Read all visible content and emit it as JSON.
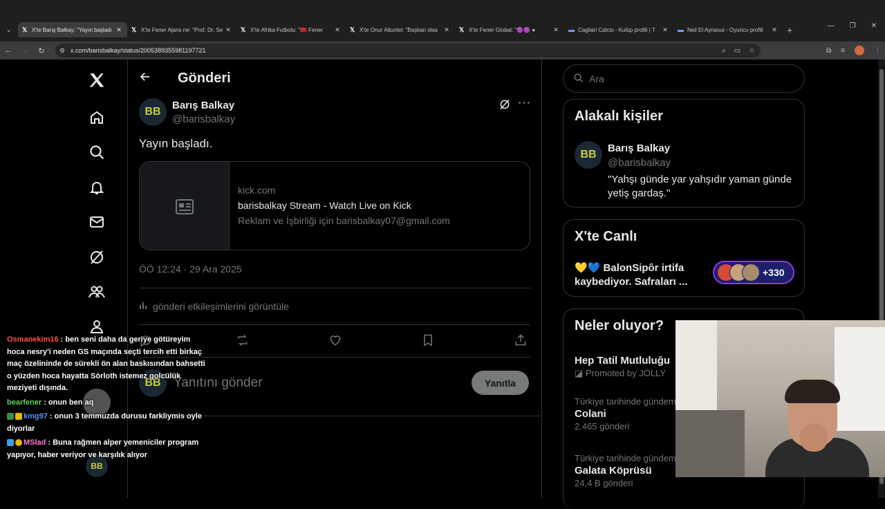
{
  "browser": {
    "tabs": [
      {
        "title": "X'te Barış Balkay: \"Yayın başladı",
        "active": true
      },
      {
        "title": "X'te Fener Ajans ne: \"Prof. Dr. Se",
        "active": false
      },
      {
        "title": "X'te Afrika Futbolu: \"🇲🇦 Fener",
        "active": false
      },
      {
        "title": "X'te Onur Altuntel: \"Başkan olsa",
        "active": false
      },
      {
        "title": "X'te Fener Global: \"🟣🟣 ●",
        "active": false
      },
      {
        "title": "Cagliari Calcio - Kulüp profili | T",
        "active": false
      },
      {
        "title": "Neil El Aynaoui - Oyuncu profili",
        "active": false
      }
    ],
    "url": "x.com/barisbalkay/status/2005389355981197721"
  },
  "main": {
    "header_title": "Gönderi",
    "author": {
      "name": "Barış Balkay",
      "handle": "@barisbalkay",
      "avatar_text": "BB"
    },
    "text": "Yayın başladı.",
    "card": {
      "domain": "kick.com",
      "title": "barisbalkay Stream - Watch Live on Kick",
      "description": "Reklam ve İşbirliği için barisbalkay07@gmail.com"
    },
    "timestamp": "ÖÖ 12:24 · 29 Ara 2025",
    "engagement_link": "gönderi etkileşimlerini görüntüle",
    "reply_placeholder": "Yanıtını gönder",
    "reply_button": "Yanıtla"
  },
  "right": {
    "search_placeholder": "Ara",
    "related_title": "Alakalı kişiler",
    "related": {
      "name": "Barış Balkay",
      "handle": "@barisbalkay",
      "bio": "\"Yahşı günde yar yahşıdır yaman günde yetiş gardaş.\""
    },
    "live_title": "X'te Canlı",
    "live": {
      "text": "💛💙 BalonSipôr irtifa kaybediyor. Safraları ...",
      "count": "+330"
    },
    "trends_title": "Neler oluyor?",
    "trends": [
      {
        "meta": "",
        "name": "Hep Tatil Mutluluğu",
        "count": "Promoted by JOLLY"
      },
      {
        "meta": "Türkiye tarihinde gündem",
        "name": "Colani",
        "count": "2.465 gönderi"
      },
      {
        "meta": "Türkiye tarihinde gündem",
        "name": "Galata Köprüsü",
        "count": "24,4 B gönderi"
      }
    ]
  },
  "chat": [
    {
      "user": "Osmanekim16",
      "text": ": ben seni daha da geriye götüreyim hoca nesry'i neden GS maçında seçti tercih etti birkaç maç özelininde de sürekli ön alan baskısından bahsetti o yüzden hoca hayatta Sörloth istemez golcülük meziyeti dışında."
    },
    {
      "user": "bearfener",
      "text": ": onun ben aq"
    },
    {
      "user": "kmg97",
      "text": ": onun 3 temmuzda durusu farkliymis oyle diyorlar"
    },
    {
      "user": "MSlad",
      "text": ": Buna rağmen alper yemeniciler program yapıyor, haber veriyor ve karşılık alıyor"
    }
  ],
  "colors": {
    "accent": "#1d9bf0",
    "border": "#2f3336",
    "muted": "#71767b"
  }
}
